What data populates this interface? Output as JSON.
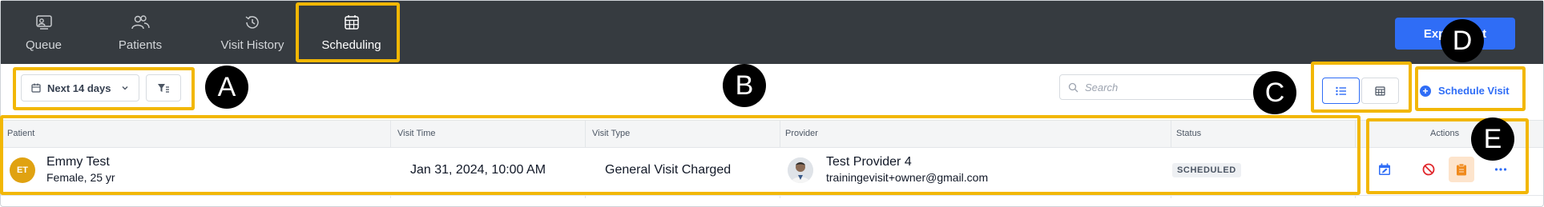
{
  "nav": {
    "tabs": [
      {
        "label": "Queue",
        "icon": "queue-icon"
      },
      {
        "label": "Patients",
        "icon": "patients-icon"
      },
      {
        "label": "Visit History",
        "icon": "history-icon"
      },
      {
        "label": "Scheduling",
        "icon": "calendar-grid-icon",
        "active": true
      }
    ],
    "export_label": "Export List"
  },
  "toolbar": {
    "date_range": "Next 14 days",
    "search_placeholder": "Search",
    "schedule_label": "Schedule Visit"
  },
  "table": {
    "headers": {
      "patient": "Patient",
      "visit_time": "Visit Time",
      "visit_type": "Visit Type",
      "provider": "Provider",
      "status": "Status",
      "actions": "Actions"
    },
    "rows": [
      {
        "initials": "ET",
        "patient_name": "Emmy Test",
        "patient_sub": "Female, 25 yr",
        "visit_time": "Jan 31, 2024, 10:00 AM",
        "visit_type": "General Visit Charged",
        "provider_name": "Test Provider 4",
        "provider_email": "trainingevisit+owner@gmail.com",
        "status": "SCHEDULED"
      }
    ]
  },
  "callouts": [
    "A",
    "B",
    "C",
    "D",
    "E"
  ],
  "colors": {
    "nav_bg": "#363b40",
    "accent": "#2f6df6",
    "highlight": "#f2b705",
    "avatar": "#e0a211",
    "danger": "#e0262b",
    "warning": "#f08a1c"
  }
}
